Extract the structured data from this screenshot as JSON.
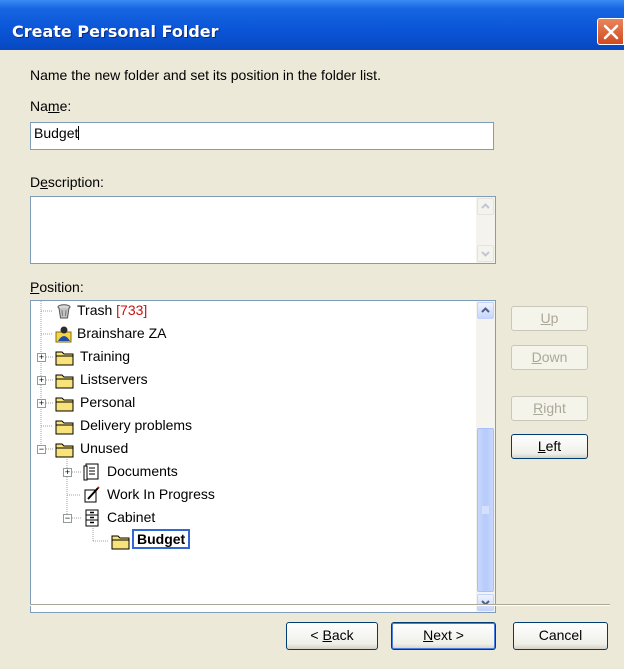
{
  "window": {
    "title": "Create Personal Folder"
  },
  "form": {
    "instruction": "Name the new folder and set its position in the folder list.",
    "name_label_pre": "Na",
    "name_label_mn": "m",
    "name_label_post": "e:",
    "name_value": "Budget",
    "description_label_pre": "D",
    "description_label_mn": "e",
    "description_label_post": "scription:",
    "description_value": "",
    "position_label_mn": "P",
    "position_label_post": "osition:"
  },
  "tree": {
    "items": [
      {
        "label": "Trash",
        "count": "[733]",
        "icon": "trash-icon"
      },
      {
        "label": "Brainshare ZA",
        "icon": "shared-user-icon"
      },
      {
        "label": "Training",
        "icon": "folder-icon"
      },
      {
        "label": "Listservers",
        "icon": "folder-icon"
      },
      {
        "label": "Personal",
        "icon": "folder-icon"
      },
      {
        "label": "Delivery problems",
        "icon": "folder-icon"
      },
      {
        "label": "Unused",
        "icon": "folder-icon"
      },
      {
        "label": "Documents",
        "icon": "documents-icon"
      },
      {
        "label": "Work In Progress",
        "icon": "work-in-progress-icon"
      },
      {
        "label": "Cabinet",
        "icon": "cabinet-icon"
      },
      {
        "label": "Budget",
        "icon": "folder-icon",
        "selected": true
      }
    ]
  },
  "side_buttons": {
    "up": {
      "mn": "U",
      "rest": "p",
      "enabled": false
    },
    "down": {
      "mn": "D",
      "rest": "own",
      "enabled": false
    },
    "right": {
      "mn": "R",
      "rest": "ight",
      "enabled": false
    },
    "left": {
      "mn": "L",
      "rest": "eft",
      "enabled": true
    }
  },
  "nav": {
    "back_pre": "< ",
    "back_mn": "B",
    "back_post": "ack",
    "next_mn": "N",
    "next_post": "ext >",
    "cancel": "Cancel"
  },
  "colors": {
    "titlebar": "#0a55d8",
    "dialog_bg": "#ece9d8",
    "trash_count": "#cc1111",
    "selection_border": "#3069d6"
  }
}
